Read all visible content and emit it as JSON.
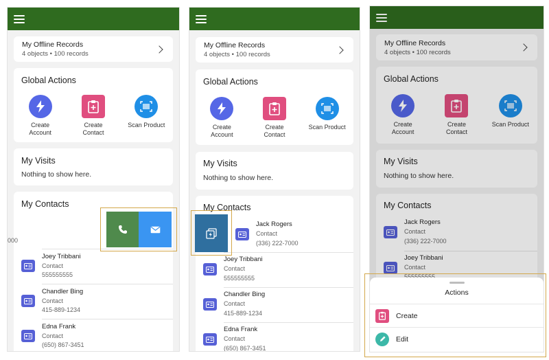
{
  "offline": {
    "title": "My Offline Records",
    "subtitle": "4 objects • 100 records"
  },
  "global_actions": {
    "title": "Global Actions",
    "items": [
      {
        "label_line1": "Create",
        "label_line2": "Account",
        "icon": "bolt-icon"
      },
      {
        "label_line1": "Create",
        "label_line2": "Contact",
        "icon": "clipboard-plus-icon"
      },
      {
        "label_line1": "Scan Product",
        "label_line2": "",
        "icon": "barcode-icon"
      }
    ]
  },
  "visits": {
    "title": "My Visits",
    "empty": "Nothing to show here."
  },
  "contacts": {
    "title": "My Contacts",
    "clipped_phone": "000",
    "items": [
      {
        "name": "Jack Rogers",
        "type": "Contact",
        "phone": "(336) 222-7000"
      },
      {
        "name": "Joey Tribbani",
        "type": "Contact",
        "phone": "555555555"
      },
      {
        "name": "Chandler Bing",
        "type": "Contact",
        "phone": "415-889-1234"
      },
      {
        "name": "Edna Frank",
        "type": "Contact",
        "phone": "(650) 867-3451"
      }
    ]
  },
  "actions_sheet": {
    "title": "Actions",
    "items": [
      {
        "label": "Create",
        "icon": "clipboard-plus-icon"
      },
      {
        "label": "Edit",
        "icon": "pencil-icon"
      }
    ]
  },
  "colors": {
    "topbar": "#2f6b1f",
    "call": "#4f8a4c",
    "email": "#3a95f2",
    "quick_action": "#2f6f9f",
    "highlight": "#d3a74a"
  }
}
